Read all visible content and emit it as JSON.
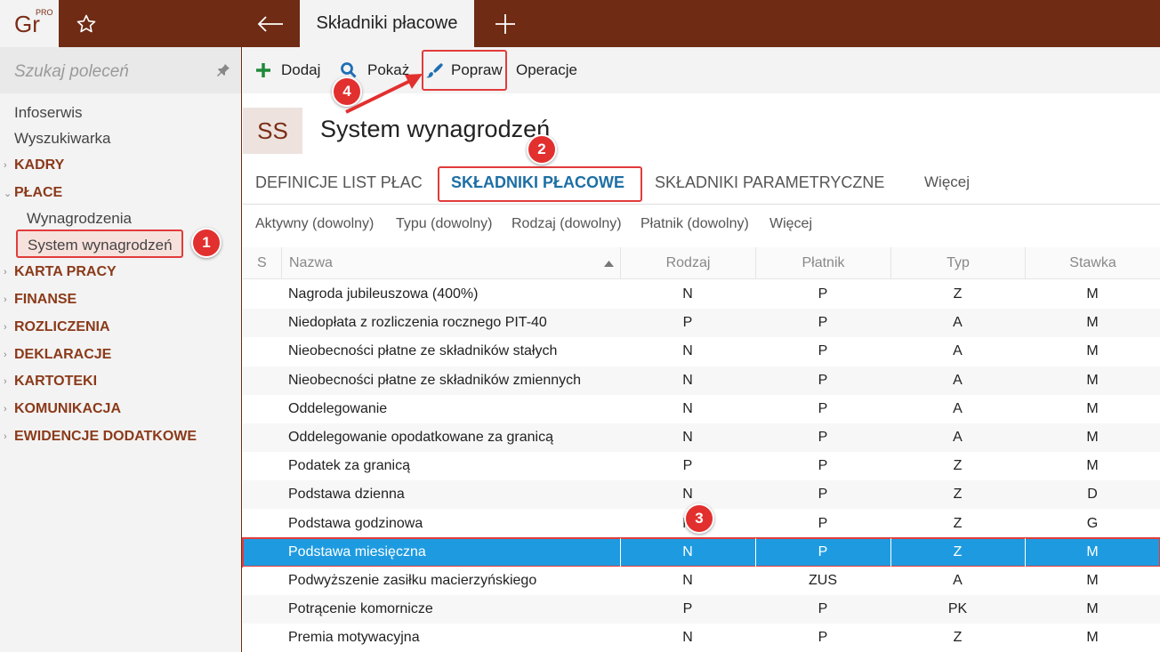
{
  "app": {
    "logo_text": "Gr",
    "logo_badge": "PRO",
    "active_tab": "Składniki płacowe"
  },
  "sidebar": {
    "search_placeholder": "Szukaj poleceń",
    "links": [
      "Infoserwis",
      "Wyszukiwarka"
    ],
    "groups": {
      "kadry": "KADRY",
      "place": "PŁACE",
      "place_sub": [
        "Wynagrodzenia",
        "System wynagrodzeń"
      ],
      "rest": [
        "KARTA PRACY",
        "FINANSE",
        "ROZLICZENIA",
        "DEKLARACJE",
        "KARTOTEKI",
        "KOMUNIKACJA",
        "EWIDENCJE DODATKOWE"
      ]
    }
  },
  "toolbar": {
    "add": "Dodaj",
    "show": "Pokaż",
    "edit": "Popraw",
    "operations": "Operacje"
  },
  "header": {
    "badge": "SS",
    "title": "System wynagrodzeń"
  },
  "tabs": [
    "DEFINICJE LIST PŁAC",
    "SKŁADNIKI PŁACOWE",
    "SKŁADNIKI PARAMETRYCZNE",
    "Więcej"
  ],
  "filters": [
    "Aktywny (dowolny)",
    "Typu (dowolny)",
    "Rodzaj (dowolny)",
    "Płatnik (dowolny)",
    "Więcej"
  ],
  "grid": {
    "columns": [
      "S",
      "Nazwa",
      "Rodzaj",
      "Płatnik",
      "Typ",
      "Stawka"
    ],
    "rows": [
      {
        "name": "Nagroda jubileuszowa (400%)",
        "rodzaj": "N",
        "platnik": "P",
        "typ": "Z",
        "stawka": "M"
      },
      {
        "name": "Niedopłata z rozliczenia rocznego PIT-40",
        "rodzaj": "P",
        "platnik": "P",
        "typ": "A",
        "stawka": "M"
      },
      {
        "name": "Nieobecności płatne ze składników stałych",
        "rodzaj": "N",
        "platnik": "P",
        "typ": "A",
        "stawka": "M"
      },
      {
        "name": "Nieobecności płatne ze składników zmiennych",
        "rodzaj": "N",
        "platnik": "P",
        "typ": "A",
        "stawka": "M"
      },
      {
        "name": "Oddelegowanie",
        "rodzaj": "N",
        "platnik": "P",
        "typ": "A",
        "stawka": "M"
      },
      {
        "name": "Oddelegowanie opodatkowane za granicą",
        "rodzaj": "N",
        "platnik": "P",
        "typ": "A",
        "stawka": "M"
      },
      {
        "name": "Podatek za granicą",
        "rodzaj": "P",
        "platnik": "P",
        "typ": "Z",
        "stawka": "M"
      },
      {
        "name": "Podstawa dzienna",
        "rodzaj": "N",
        "platnik": "P",
        "typ": "Z",
        "stawka": "D"
      },
      {
        "name": "Podstawa godzinowa",
        "rodzaj": "N",
        "platnik": "P",
        "typ": "Z",
        "stawka": "G"
      },
      {
        "name": "Podstawa miesięczna",
        "rodzaj": "N",
        "platnik": "P",
        "typ": "Z",
        "stawka": "M"
      },
      {
        "name": "Podwyższenie zasiłku macierzyńskiego",
        "rodzaj": "N",
        "platnik": "ZUS",
        "typ": "A",
        "stawka": "M"
      },
      {
        "name": "Potrącenie komornicze",
        "rodzaj": "P",
        "platnik": "P",
        "typ": "PK",
        "stawka": "M"
      },
      {
        "name": "Premia motywacyjna",
        "rodzaj": "N",
        "platnik": "P",
        "typ": "Z",
        "stawka": "M"
      }
    ]
  },
  "markers": [
    "1",
    "2",
    "3",
    "4"
  ],
  "colors": {
    "brand": "#6f2b14",
    "selection": "#1e9be0",
    "highlight": "#e23b3b",
    "active_tab_text": "#1d6fa5"
  }
}
